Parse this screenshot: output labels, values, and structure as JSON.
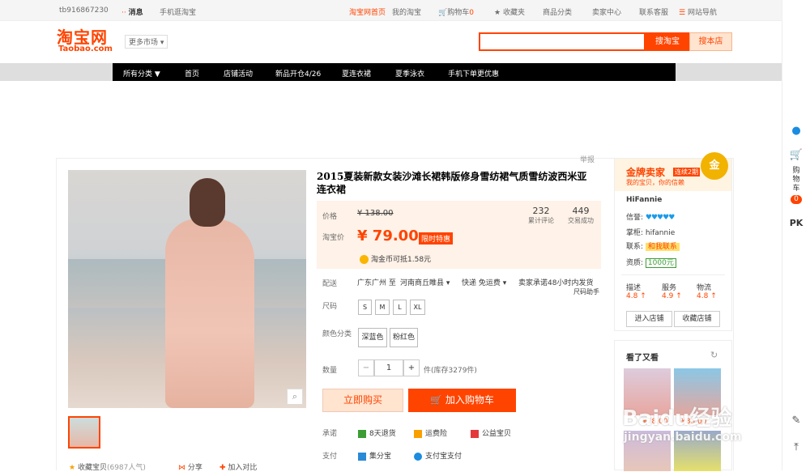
{
  "topbar": {
    "user": "tb916867230",
    "messages": "消息",
    "mobile": "手机逛淘宝",
    "home": "淘宝网首页",
    "my_taobao": "我的淘宝",
    "cart": "购物车",
    "cart_count": "0",
    "favorites": "收藏夹",
    "categories": "商品分类",
    "seller_center": "卖家中心",
    "support": "联系客服",
    "site_nav": "网站导航"
  },
  "header": {
    "logo_cn": "淘宝网",
    "logo_en": "Taobao.com",
    "more_market": "更多市场",
    "search_value": "",
    "search_taobao": "搜淘宝",
    "search_shop": "搜本店"
  },
  "nav": {
    "all_categories": "所有分类 ▼",
    "items": [
      "首页",
      "店铺活动",
      "新品开仓4/26",
      "夏连衣裙",
      "夏季泳衣",
      "手机下单更优惠"
    ]
  },
  "product": {
    "report": "举报",
    "title": "2015夏装新款女装沙滩长裙韩版修身雪纺裙气质雪纺波西米亚连衣裙",
    "price_label": "价格",
    "original_price": "¥ 138.00",
    "promo_label": "淘宝价",
    "promo_price": "¥ 79.00",
    "promo_badge": "限时特惠",
    "reviews_count": "232",
    "reviews_label": "累计评论",
    "sales_count": "449",
    "sales_label": "交易成功",
    "coin_text": "淘金币可抵1.58元",
    "shipping_label": "配送",
    "ship_from": "广东广州 至",
    "ship_to": "河南商丘睢县",
    "ship_method": "快递 免运费",
    "ship_promise": "卖家承诺48小时内发货",
    "size_label": "尺码",
    "size_guide": "尺码助手",
    "sizes": [
      "S",
      "M",
      "L",
      "XL"
    ],
    "color_label": "颜色分类",
    "colors": [
      "深蓝色",
      "粉红色"
    ],
    "qty_label": "数量",
    "qty_value": "1",
    "qty_minus": "−",
    "qty_plus": "+",
    "stock": "件(库存3279件)",
    "buy_now": "立即购买",
    "add_cart": "加入购物车",
    "promise_label": "承诺",
    "promises": [
      "8天退货",
      "运费险",
      "公益宝贝"
    ],
    "pay_label": "支付",
    "payments": [
      "集分宝",
      "支付宝支付"
    ],
    "favorite": "收藏宝贝",
    "popularity": "(6987人气)",
    "share": "分享",
    "compare": "加入对比"
  },
  "seller": {
    "badge_title": "金牌卖家",
    "badge_term": "连续2期",
    "badge_sub": "我的宝贝，你的信赖",
    "medal": "金",
    "shop_name": "HiFannie",
    "credit_label": "信誉:",
    "hearts": "♥♥♥♥♥",
    "owner_label": "掌柜:",
    "owner": "hifannie",
    "contact_label": "联系:",
    "contact_btn": "和我联系",
    "qual_label": "资质:",
    "deposit": "1000元",
    "rating_labels": [
      "描述",
      "服务",
      "物流"
    ],
    "rating_values": [
      "4.8",
      "4.9",
      "4.8"
    ],
    "enter_shop": "进入店铺",
    "fav_shop": "收藏店铺"
  },
  "also_viewed": {
    "title": "看了又看",
    "price1": "¥78.00",
    "price2": "¥85.00"
  },
  "sidebar": {
    "cart": "购物车",
    "cart_count": "0",
    "pk": "PK"
  },
  "watermark": {
    "brand": "Baidu经验",
    "url": "jingyan.baidu.com"
  },
  "colors": {
    "accent": "#ff4400",
    "nav_bg": "#000000",
    "price_bg": "#fff2e8"
  }
}
